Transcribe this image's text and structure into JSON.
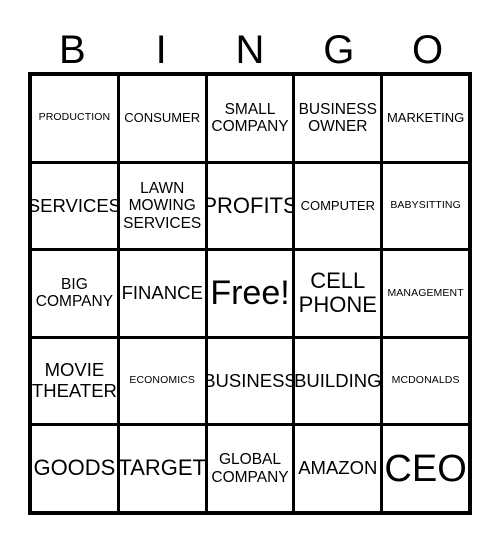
{
  "card": {
    "title": "Bingo Card",
    "header": {
      "letters": [
        "B",
        "I",
        "N",
        "G",
        "O"
      ]
    },
    "free_space": {
      "label": "Free!",
      "row": 2,
      "column": 2
    },
    "grid": {
      "rows": 5,
      "columns": 5,
      "border_color": "#000000",
      "background_color": "#ffffff",
      "cells": [
        [
          {
            "text": "PRODUCTION",
            "size": "xs"
          },
          {
            "text": "CONSUMER",
            "size": "sm"
          },
          {
            "text": "SMALL\nCOMPANY",
            "size": "md"
          },
          {
            "text": "BUSINESS\nOWNER",
            "size": "md"
          },
          {
            "text": "MARKETING",
            "size": "sm"
          }
        ],
        [
          {
            "text": "SERVICES",
            "size": "lg"
          },
          {
            "text": "LAWN\nMOWING\nSERVICES",
            "size": "md"
          },
          {
            "text": "PROFITS",
            "size": "xl"
          },
          {
            "text": "COMPUTER",
            "size": "sm"
          },
          {
            "text": "BABYSITTING",
            "size": "xs"
          }
        ],
        [
          {
            "text": "BIG\nCOMPANY",
            "size": "md"
          },
          {
            "text": "FINANCE",
            "size": "lg"
          },
          {
            "text": "Free!",
            "size": "free"
          },
          {
            "text": "CELL\nPHONE",
            "size": "xl"
          },
          {
            "text": "MANAGEMENT",
            "size": "xs"
          }
        ],
        [
          {
            "text": "MOVIE\nTHEATER",
            "size": "lg"
          },
          {
            "text": "ECONOMICS",
            "size": "xs"
          },
          {
            "text": "BUSINESS",
            "size": "lg"
          },
          {
            "text": "BUILDING",
            "size": "lg"
          },
          {
            "text": "MCDONALDS",
            "size": "xs"
          }
        ],
        [
          {
            "text": "GOODS",
            "size": "xl"
          },
          {
            "text": "TARGET",
            "size": "xl"
          },
          {
            "text": "GLOBAL\nCOMPANY",
            "size": "md"
          },
          {
            "text": "AMAZON",
            "size": "lg"
          },
          {
            "text": "CEO",
            "size": "ceo"
          }
        ]
      ]
    }
  }
}
